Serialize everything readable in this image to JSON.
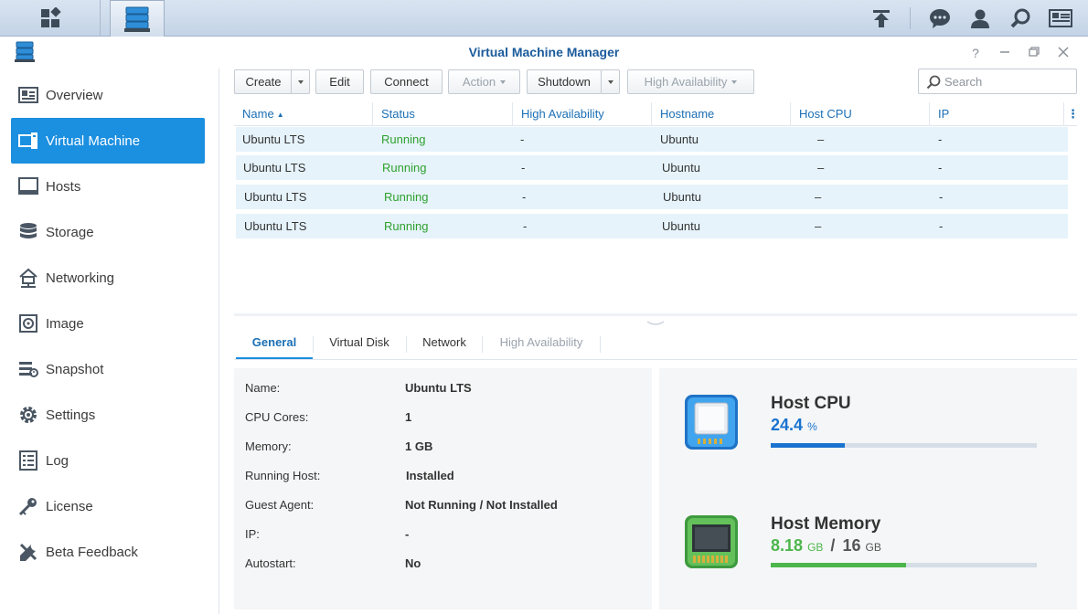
{
  "window": {
    "title": "Virtual Machine Manager"
  },
  "sidebar": {
    "items": [
      {
        "label": "Overview",
        "icon": "overview-icon"
      },
      {
        "label": "Virtual Machine",
        "icon": "virtual-machine-icon",
        "active": true
      },
      {
        "label": "Hosts",
        "icon": "monitor-icon"
      },
      {
        "label": "Storage",
        "icon": "database-icon"
      },
      {
        "label": "Networking",
        "icon": "network-house-icon"
      },
      {
        "label": "Image",
        "icon": "image-disc-icon"
      },
      {
        "label": "Snapshot",
        "icon": "snapshot-icon"
      },
      {
        "label": "Settings",
        "icon": "gear-icon"
      },
      {
        "label": "Log",
        "icon": "log-list-icon"
      },
      {
        "label": "License",
        "icon": "key-icon"
      },
      {
        "label": "Beta Feedback",
        "icon": "wrench-icon"
      }
    ]
  },
  "toolbar": {
    "create": "Create",
    "edit": "Edit",
    "connect": "Connect",
    "action": "Action",
    "shutdown": "Shutdown",
    "high_availability": "High Availability",
    "search_placeholder": "Search"
  },
  "grid": {
    "columns": [
      "Name",
      "Status",
      "High Availability",
      "Hostname",
      "Host CPU",
      "IP"
    ],
    "rows": [
      {
        "name": "Ubuntu LTS",
        "status": "Running",
        "ha": "-",
        "hostname": "Ubuntu",
        "cpu": "–",
        "ip": "-"
      },
      {
        "name": "Ubuntu LTS",
        "status": "Running",
        "ha": "-",
        "hostname": "Ubuntu",
        "cpu": "–",
        "ip": "-"
      },
      {
        "name": "Ubuntu LTS",
        "status": "Running",
        "ha": "-",
        "hostname": "Ubuntu",
        "cpu": "–",
        "ip": "-"
      },
      {
        "name": "Ubuntu LTS",
        "status": "Running",
        "ha": "-",
        "hostname": "Ubuntu",
        "cpu": "–",
        "ip": "-"
      }
    ]
  },
  "tabs": [
    "General",
    "Virtual Disk",
    "Network",
    "High Availability"
  ],
  "general": [
    {
      "label": "Name:",
      "value": "Ubuntu LTS"
    },
    {
      "label": "CPU Cores:",
      "value": "1"
    },
    {
      "label": "Memory:",
      "value": "1 GB"
    },
    {
      "label": "Running Host:",
      "value": "Installed"
    },
    {
      "label": "Guest Agent:",
      "value": "Not Running / Not Installed"
    },
    {
      "label": "IP:",
      "value": "-"
    },
    {
      "label": "Autostart:",
      "value": "No"
    }
  ],
  "host_cpu": {
    "title": "Host CPU",
    "value": "24.4",
    "unit": "%",
    "fraction": 0.28
  },
  "host_memory": {
    "title": "Host Memory",
    "used": "8.18",
    "used_unit": "GB",
    "separator": "/",
    "total": "16",
    "total_unit": "GB",
    "fraction": 0.51
  },
  "colors": {
    "accent": "#1b8fe0",
    "running": "#2ea12e",
    "cpu_bar": "#1a74cf",
    "memory_bar": "#4cb64c"
  }
}
